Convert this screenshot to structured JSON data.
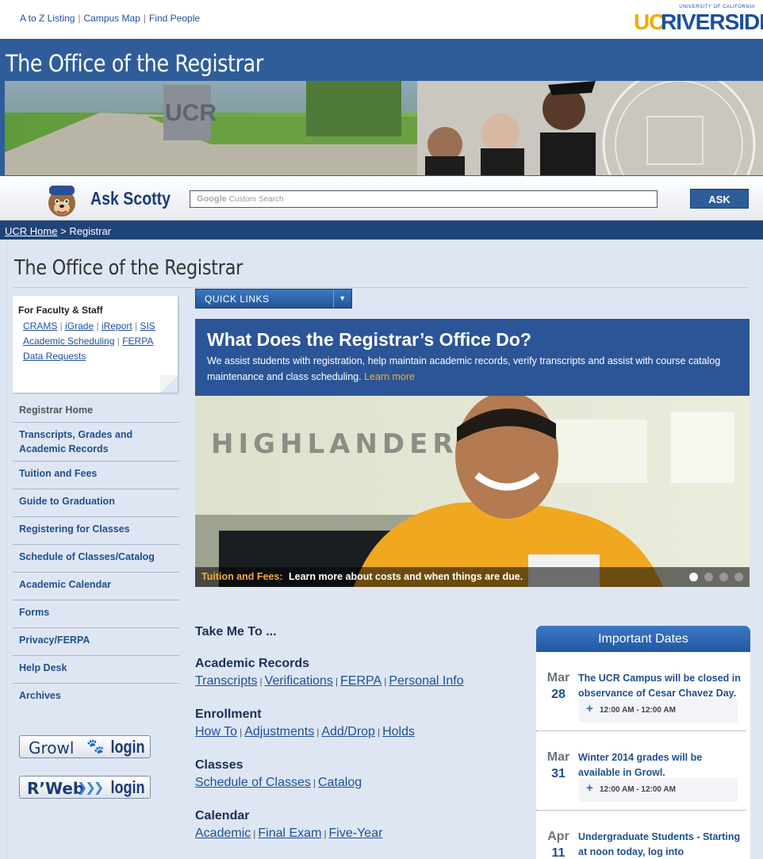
{
  "top": {
    "links": [
      "A to Z Listing",
      "Campus Map",
      "Find People"
    ],
    "logo_small": "UNIVERSITY OF CALIFORNIA",
    "logo_uc": "UC",
    "logo_riverside": "RIVERSIDE"
  },
  "header": {
    "title": "The Office of the Registrar"
  },
  "ask": {
    "title": "Ask Scotty",
    "search_brand": "Google",
    "search_placeholder": "Custom Search",
    "button": "ASK"
  },
  "breadcrumb": {
    "home": "UCR Home",
    "sep": ">",
    "current": "Registrar"
  },
  "page_title": "The Office of the Registrar",
  "faculty": {
    "heading": "For Faculty & Staff",
    "rows": [
      [
        "CRAMS",
        "iGrade",
        "iReport",
        "SIS"
      ],
      [
        "Academic Scheduling",
        "FERPA"
      ],
      [
        "Data Requests"
      ]
    ]
  },
  "nav": [
    "Registrar Home",
    "Transcripts, Grades and Academic Records",
    "Tuition and Fees",
    "Guide to Graduation",
    "Registering for Classes",
    "Schedule of Classes/Catalog",
    "Academic Calendar",
    "Forms",
    "Privacy/FERPA",
    "Help Desk",
    "Archives"
  ],
  "logins": {
    "growl": "Growl",
    "rweb": "R’Web",
    "login": "login"
  },
  "quick_links": {
    "label": "QUICK LINKS"
  },
  "hero": {
    "heading": "What Does the Registrar’s Office Do?",
    "description": "We assist students with registration, help maintain academic records, verify transcripts and assist with course catalog maintenance and class scheduling.",
    "learn_more": "Learn more",
    "photo_text": "HIGHLANDER P",
    "caption_category": "Tuition and Fees:",
    "caption_text": "Learn more about costs and when things are due.",
    "slide_count": 4,
    "active_slide": 1
  },
  "take_me_to": "Take Me To ...",
  "sections": [
    {
      "heading": "Academic Records",
      "links": [
        "Transcripts",
        "Verifications",
        "FERPA",
        "Personal Info"
      ]
    },
    {
      "heading": "Enrollment",
      "links": [
        "How To",
        "Adjustments",
        "Add/Drop",
        "Holds"
      ]
    },
    {
      "heading": "Classes",
      "links": [
        "Schedule of Classes",
        "Catalog"
      ]
    },
    {
      "heading": "Calendar",
      "links": [
        "Academic",
        "Final Exam",
        "Five-Year"
      ]
    }
  ],
  "important_dates": {
    "heading": "Important Dates",
    "events": [
      {
        "month": "Mar",
        "day": "28",
        "text": "The UCR Campus will be closed in observance of Cesar Chavez Day.",
        "time": "12:00 AM - 12:00 AM"
      },
      {
        "month": "Mar",
        "day": "31",
        "text": "Winter 2014 grades will be available in Growl.",
        "time": "12:00 AM - 12:00 AM"
      },
      {
        "month": "Apr",
        "day": "11",
        "text": "Undergraduate Students - Starting at noon today, log into",
        "time": ""
      }
    ]
  }
}
